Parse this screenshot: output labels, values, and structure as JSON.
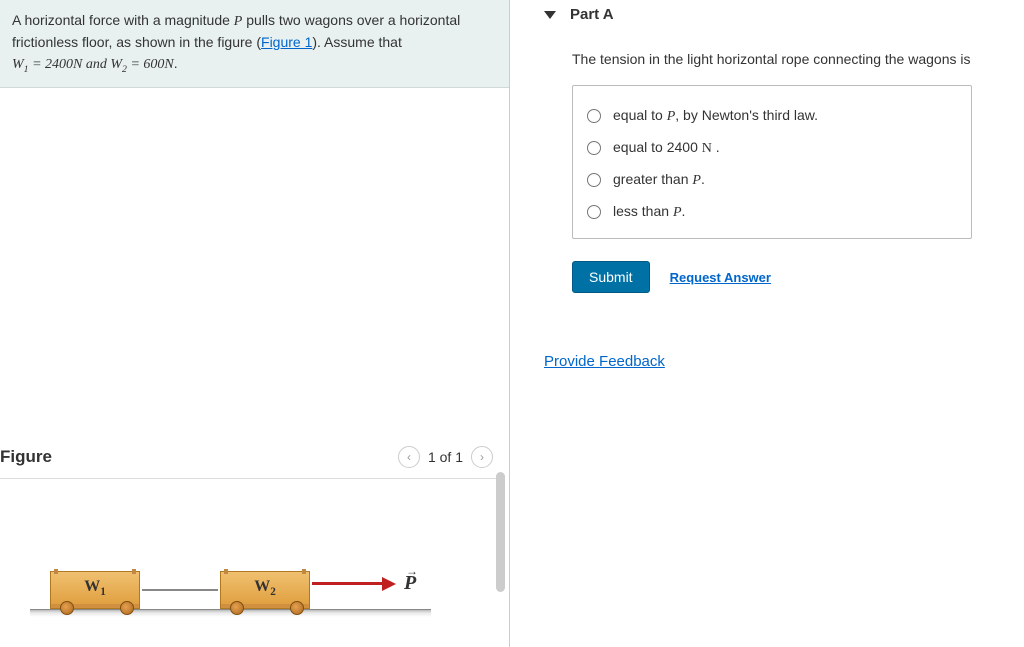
{
  "problem": {
    "text_pre": "A horizontal force with a magnitude ",
    "P": "P",
    "text_mid1": " pulls two wagons over a horizontal frictionless floor, as shown in the figure (",
    "figure_link": "Figure 1",
    "text_mid2": "). Assume that ",
    "eq": "W₁ = 2400N and W₂ = 600N",
    "period": "."
  },
  "figure": {
    "title": "Figure",
    "pager": "1 of 1",
    "w1": "W₁",
    "w2": "W₂",
    "p_label": "P"
  },
  "part": {
    "label": "Part A",
    "question": "The tension in the light horizontal rope connecting the wagons is",
    "options": [
      {
        "pre": "equal to ",
        "mathP": "P",
        "post": ", by Newton's third law."
      },
      {
        "pre": "equal to 2400 ",
        "mathN": "N",
        "post": " ."
      },
      {
        "pre": "greater than ",
        "mathP": "P",
        "post": "."
      },
      {
        "pre": "less than ",
        "mathP": "P",
        "post": "."
      }
    ],
    "submit": "Submit",
    "request": "Request Answer"
  },
  "feedback": "Provide Feedback"
}
